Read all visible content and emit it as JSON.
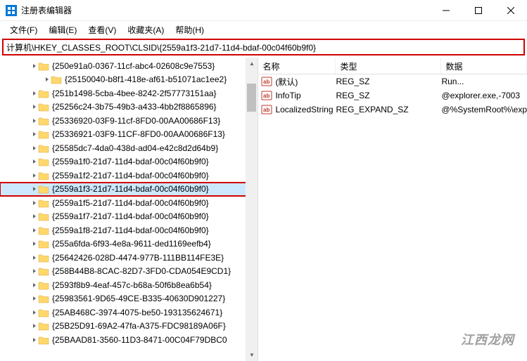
{
  "window": {
    "title": "注册表编辑器"
  },
  "menu": {
    "file": "文件(F)",
    "edit": "编辑(E)",
    "view": "查看(V)",
    "favorites": "收藏夹(A)",
    "help": "帮助(H)"
  },
  "address": "计算机\\HKEY_CLASSES_ROOT\\CLSID\\{2559a1f3-21d7-11d4-bdaf-00c04f60b9f0}",
  "tree": [
    {
      "label": "{250e91a0-0367-11cf-abc4-02608c9e7553}"
    },
    {
      "label": "{25150040-b8f1-418e-af61-b51071ac1ee2}",
      "deep": true
    },
    {
      "label": "{251b1498-5cba-4bee-8242-2f57773151aa}"
    },
    {
      "label": "{25256c24-3b75-49b3-a433-4bb2f8865896}"
    },
    {
      "label": "{25336920-03F9-11cf-8FD0-00AA00686F13}"
    },
    {
      "label": "{25336921-03F9-11CF-8FD0-00AA00686F13}"
    },
    {
      "label": "{25585dc7-4da0-438d-ad04-e42c8d2d64b9}"
    },
    {
      "label": "{2559a1f0-21d7-11d4-bdaf-00c04f60b9f0}"
    },
    {
      "label": "{2559a1f2-21d7-11d4-bdaf-00c04f60b9f0}"
    },
    {
      "label": "{2559a1f3-21d7-11d4-bdaf-00c04f60b9f0}",
      "selected": true
    },
    {
      "label": "{2559a1f5-21d7-11d4-bdaf-00c04f60b9f0}"
    },
    {
      "label": "{2559a1f7-21d7-11d4-bdaf-00c04f60b9f0}"
    },
    {
      "label": "{2559a1f8-21d7-11d4-bdaf-00c04f60b9f0}"
    },
    {
      "label": "{255a6fda-6f93-4e8a-9611-ded1169eefb4}"
    },
    {
      "label": "{25642426-028D-4474-977B-111BB114FE3E}"
    },
    {
      "label": "{258B44B8-8CAC-82D7-3FD0-CDA054E9CD1}"
    },
    {
      "label": "{2593f8b9-4eaf-457c-b68a-50f6b8ea6b54}"
    },
    {
      "label": "{25983561-9D65-49CE-B335-40630D901227}"
    },
    {
      "label": "{25AB468C-3974-4075-be50-193135624671}"
    },
    {
      "label": "{25B25D91-69A2-47fa-A375-FDC98189A06F}"
    },
    {
      "label": "{25BAAD81-3560-11D3-8471-00C04F79DBC0"
    }
  ],
  "list": {
    "headers": {
      "name": "名称",
      "type": "类型",
      "data": "数据"
    },
    "rows": [
      {
        "name": "(默认)",
        "type": "REG_SZ",
        "data": "Run..."
      },
      {
        "name": "InfoTip",
        "type": "REG_SZ",
        "data": "@explorer.exe,-7003"
      },
      {
        "name": "LocalizedString",
        "type": "REG_EXPAND_SZ",
        "data": "@%SystemRoot%\\exp"
      }
    ]
  },
  "watermark": "江西龙网"
}
